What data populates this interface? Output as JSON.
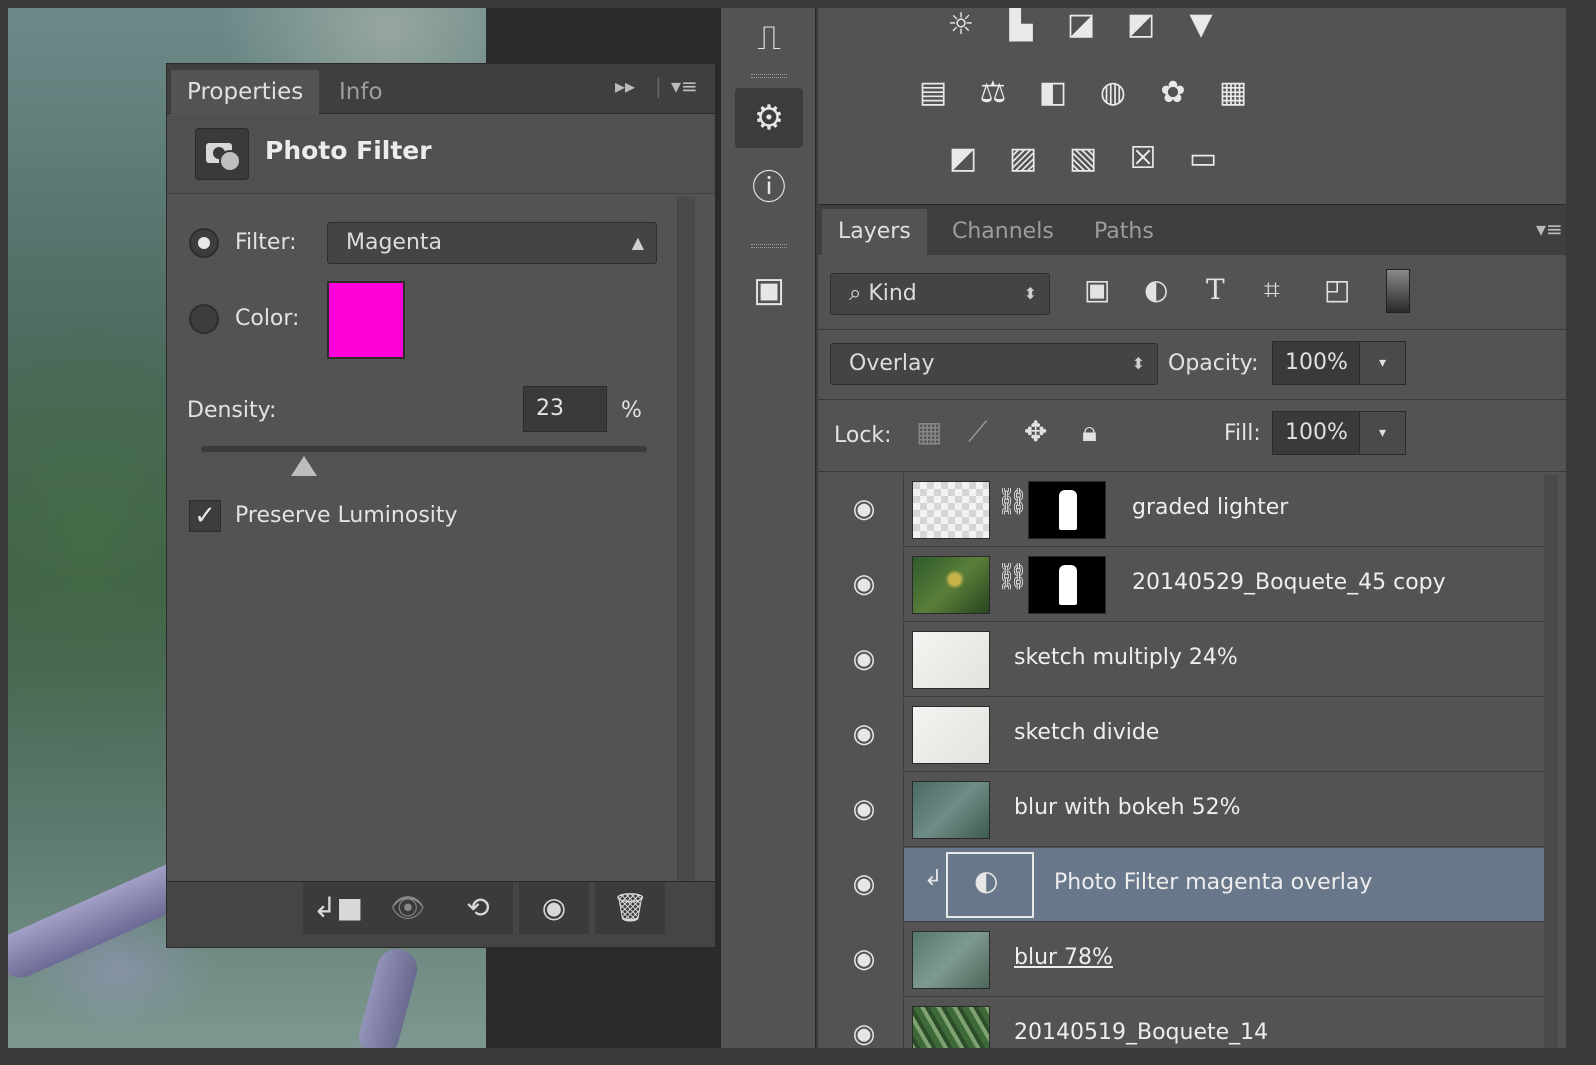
{
  "properties_panel": {
    "tabs": [
      "Properties",
      "Info"
    ],
    "adjustment_title": "Photo Filter",
    "filter_label": "Filter:",
    "filter_value": "Magenta",
    "color_label": "Color:",
    "color_swatch": "#ff00d8",
    "density_label": "Density:",
    "density_value": "23",
    "density_unit": "%",
    "density_fraction": 0.23,
    "preserve_luminosity_label": "Preserve Luminosity",
    "preserve_luminosity_checked": true
  },
  "layers_panel": {
    "tabs": [
      "Layers",
      "Channels",
      "Paths"
    ],
    "filter_kind": "Kind",
    "blend_mode": "Overlay",
    "opacity_label": "Opacity:",
    "opacity_value": "100%",
    "lock_label": "Lock:",
    "fill_label": "Fill:",
    "fill_value": "100%",
    "layers": [
      {
        "name": "graded lighter",
        "thumb": "transparent",
        "mask": true,
        "selected": false
      },
      {
        "name": "20140529_Boquete_45 copy",
        "thumb": "photo",
        "mask": true,
        "selected": false
      },
      {
        "name": "sketch multiply 24%",
        "thumb": "sketch",
        "mask": false,
        "selected": false
      },
      {
        "name": "sketch divide",
        "thumb": "sketch",
        "mask": false,
        "selected": false
      },
      {
        "name": "blur with bokeh 52%",
        "thumb": "blur",
        "mask": false,
        "selected": false
      },
      {
        "name": "Photo Filter magenta overlay",
        "thumb": "adjustment",
        "mask": false,
        "selected": true
      },
      {
        "name": "blur 78% ",
        "thumb": "blur",
        "mask": false,
        "selected": false
      },
      {
        "name": "20140519_Boquete_14",
        "thumb": "photo",
        "mask": false,
        "selected": false
      }
    ]
  },
  "colors": {
    "panel_bg": "#535353",
    "selected_layer": "#68778a",
    "magenta": "#ff00d8"
  }
}
